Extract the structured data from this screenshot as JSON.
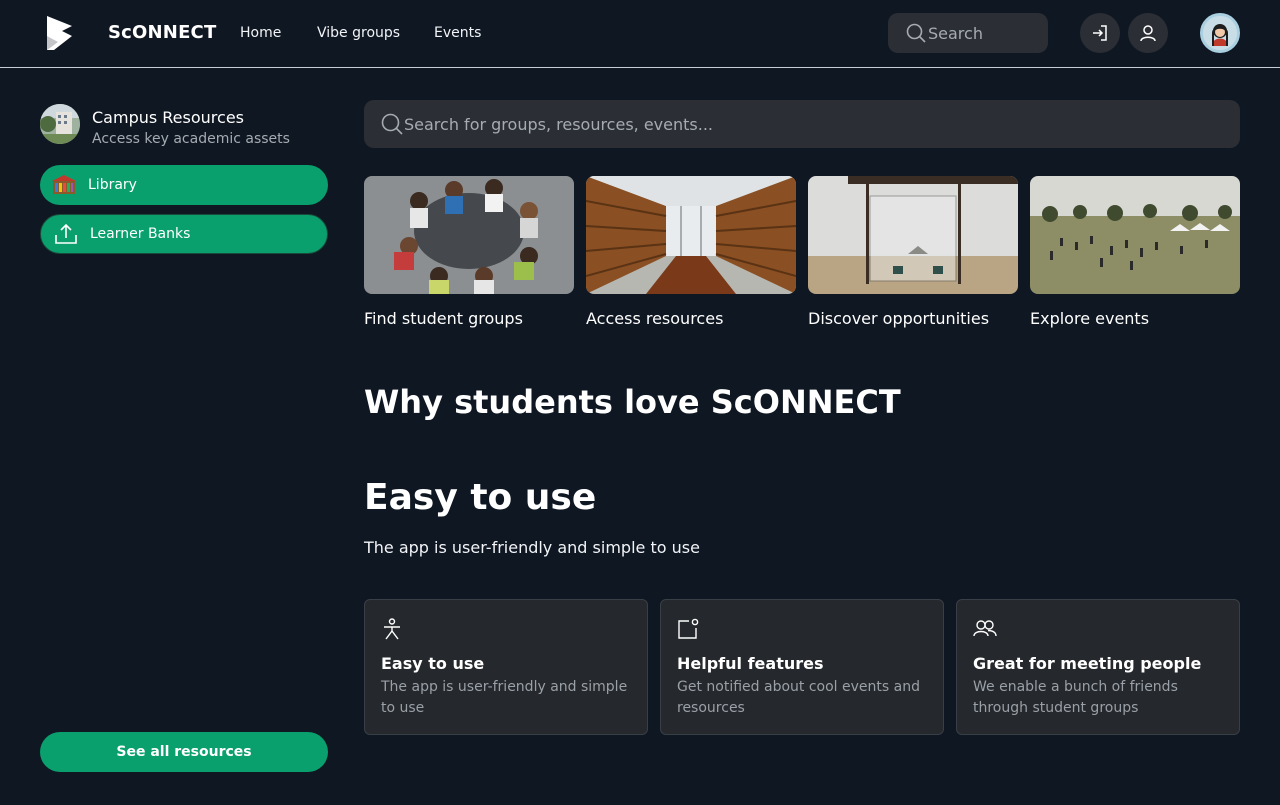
{
  "header": {
    "brand": "ScONNECT",
    "nav": [
      "Home",
      "Vibe groups",
      "Events"
    ],
    "search_placeholder": "Search",
    "icons": [
      "search-icon",
      "login-icon",
      "user-icon",
      "profile-avatar"
    ]
  },
  "sidebar": {
    "title": "Campus Resources",
    "subtitle": "Access key academic assets",
    "items": [
      {
        "label": "Library",
        "icon": "library-icon"
      },
      {
        "label": "Learner Banks",
        "icon": "upload-icon"
      }
    ],
    "see_all": "See all resources"
  },
  "main": {
    "search_placeholder": "Search for groups, resources, events...",
    "cards": [
      {
        "label": "Find student groups"
      },
      {
        "label": "Access resources"
      },
      {
        "label": "Discover opportunities"
      },
      {
        "label": "Explore events"
      }
    ],
    "why_title": "Why students love ScONNECT",
    "easy_title": "Easy to use",
    "easy_sub": "The app is user-friendly and simple to use",
    "features": [
      {
        "title": "Easy to use",
        "desc": "The app is user-friendly and simple to use",
        "icon": "person-icon"
      },
      {
        "title": "Helpful features",
        "desc": "Get notified about cool events and resources",
        "icon": "notification-icon"
      },
      {
        "title": "Great for meeting people",
        "desc": "We enable a bunch of friends through student groups",
        "icon": "people-icon"
      }
    ]
  },
  "colors": {
    "background": "#0f1722",
    "accent": "#0aa06e",
    "surface": "#2b2f35"
  }
}
